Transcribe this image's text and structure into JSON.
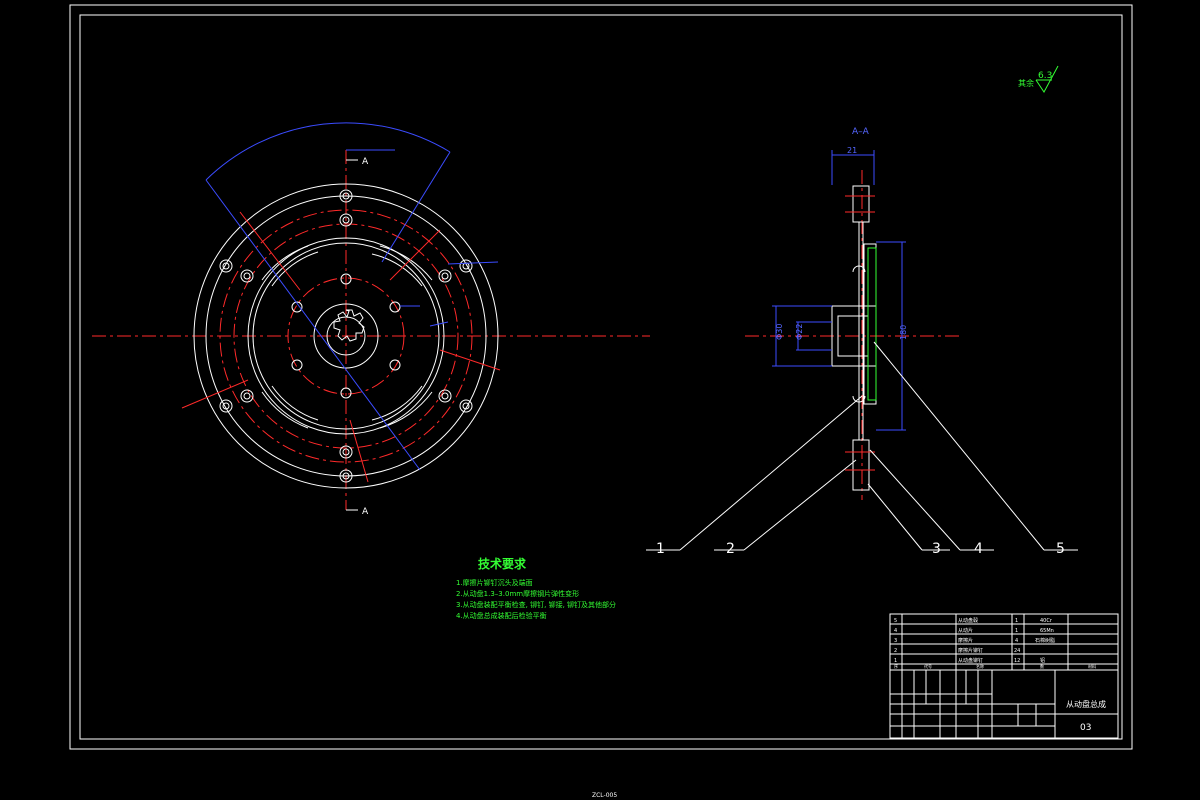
{
  "frame": {
    "border_color": "#ffffff",
    "centerline_color": "#ff2a2a",
    "dimension_color": "#3b4cff",
    "text_color": "#33ff33"
  },
  "front_view": {
    "section_label_top": "A",
    "section_label_bottom": "A"
  },
  "section_view": {
    "title": "A–A",
    "dim_width": "21",
    "dim_d1": "Φ30",
    "dim_d2": "Φ22",
    "dim_height": "180"
  },
  "roughness": {
    "value": "6.3",
    "prefix": "其余"
  },
  "tech_requirements": {
    "title": "技术要求",
    "items": [
      "1.摩擦片铆钉沉头及端面",
      "2.从动盘1.3–3.0mm摩擦钢片弹性变形",
      "3.从动盘装配平衡检查, 铆钉, 铆接, 铆钉及其他部分",
      "4.从动盘总成装配后检验平衡"
    ]
  },
  "balloons": [
    "1",
    "2",
    "3",
    "4",
    "5"
  ],
  "title_block": {
    "part_name": "从动盘总成",
    "drawing_code": "03",
    "bom_rows": [
      {
        "no": "5",
        "name": "从动盘毂",
        "qty": "1",
        "material": "40Cr"
      },
      {
        "no": "4",
        "name": "从动片",
        "qty": "1",
        "material": "65Mn"
      },
      {
        "no": "3",
        "name": "摩擦片",
        "qty": "4",
        "material": "石棉树脂"
      },
      {
        "no": "2",
        "name": "摩擦片铆钉",
        "qty": "24",
        "material": ""
      },
      {
        "no": "1",
        "name": "从动盘铆钉",
        "qty": "12",
        "material": "铝"
      }
    ],
    "bom_header": {
      "no": "序",
      "code": "代号",
      "name": "名称",
      "qty": "数",
      "material": "材料"
    }
  },
  "footer_code": "ZCL-005"
}
